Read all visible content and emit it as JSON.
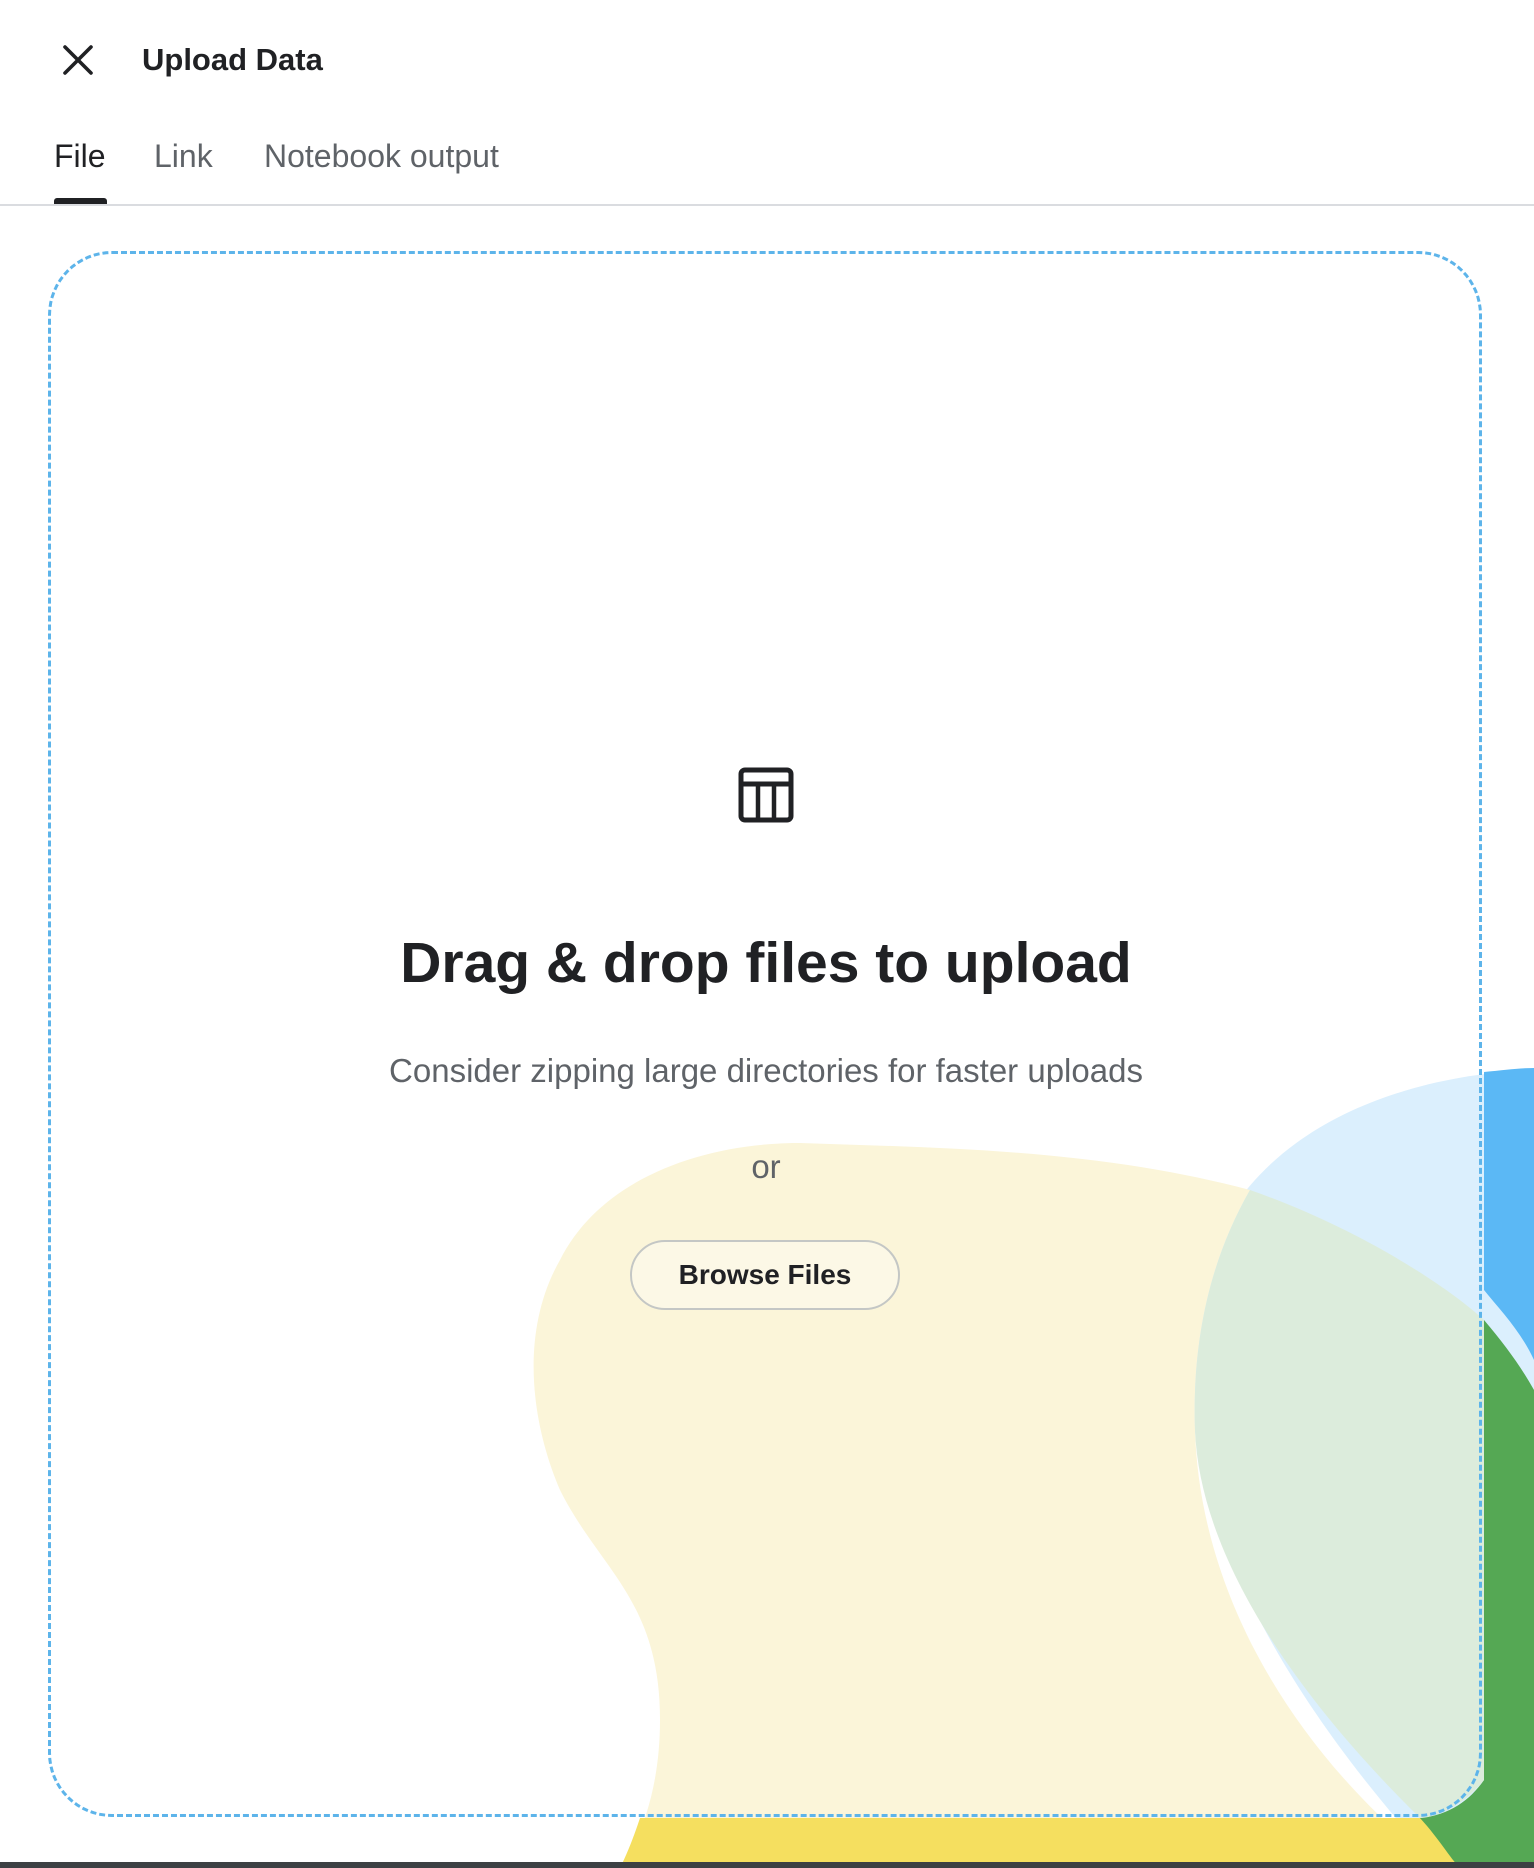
{
  "header": {
    "title": "Upload Data",
    "close_icon": "close-icon"
  },
  "tabs": [
    {
      "label": "File",
      "active": true
    },
    {
      "label": "Link",
      "active": false
    },
    {
      "label": "Notebook output",
      "active": false
    }
  ],
  "dropzone": {
    "icon": "table-icon",
    "heading": "Drag & drop files to upload",
    "subtext": "Consider zipping large directories for faster uploads",
    "or_text": "or",
    "browse_label": "Browse Files"
  },
  "colors": {
    "dropzone_border": "#5db4ea",
    "accent_blue": "#5bb8f5",
    "accent_green": "#55a854",
    "accent_yellow": "#f5df5f",
    "text_primary": "#202124",
    "text_secondary": "#5f6368"
  }
}
